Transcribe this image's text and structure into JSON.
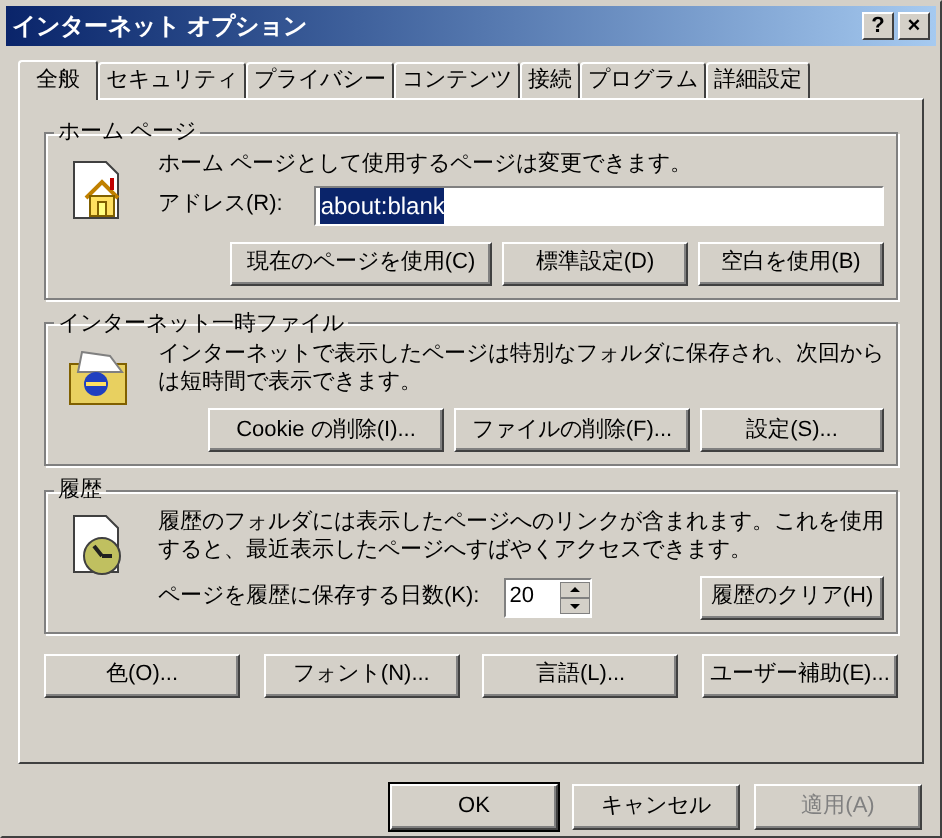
{
  "window": {
    "title": "インターネット オプション",
    "title_buttons": [
      "?",
      "×"
    ]
  },
  "tabs": [
    {
      "label": "全般",
      "selected": true
    },
    {
      "label": "セキュリティ",
      "selected": false
    },
    {
      "label": "プライバシー",
      "selected": false
    },
    {
      "label": "コンテンツ",
      "selected": false
    },
    {
      "label": "接続",
      "selected": false
    },
    {
      "label": "プログラム",
      "selected": false
    },
    {
      "label": "詳細設定",
      "selected": false
    }
  ],
  "home_page": {
    "title": "ホーム ページ",
    "description": "ホーム ページとして使用するページは変更できます。",
    "address_label": "アドレス(R):",
    "address_value": "about:blank",
    "value_selected": true,
    "buttons": [
      "現在のページを使用(C)",
      "標準設定(D)",
      "空白を使用(B)"
    ]
  },
  "temporary_files": {
    "title": "インターネット一時ファイル",
    "description": "インターネットで表示したページは特別なフォルダに保存され、次回からは短時間で表示できます。",
    "buttons": [
      "Cookie の削除(I)...",
      "ファイルの削除(F)...",
      "設定(S)..."
    ]
  },
  "history": {
    "title": "履歴",
    "description": "履歴のフォルダには表示したページへのリンクが含まれます。これを使用すると、最近表示したページへすばやくアクセスできます。",
    "days_label": "ページを履歴に保存する日数(K):",
    "days_value": "20",
    "clear_button": "履歴のクリア(H)"
  },
  "bottom_buttons": [
    "色(O)...",
    "フォント(N)...",
    "言語(L)...",
    "ユーザー補助(E)..."
  ],
  "dialog_buttons": [
    {
      "label": "OK",
      "default": true,
      "disabled": false
    },
    {
      "label": "キャンセル",
      "default": false,
      "disabled": false
    },
    {
      "label": "適用(A)",
      "default": false,
      "disabled": true
    }
  ]
}
